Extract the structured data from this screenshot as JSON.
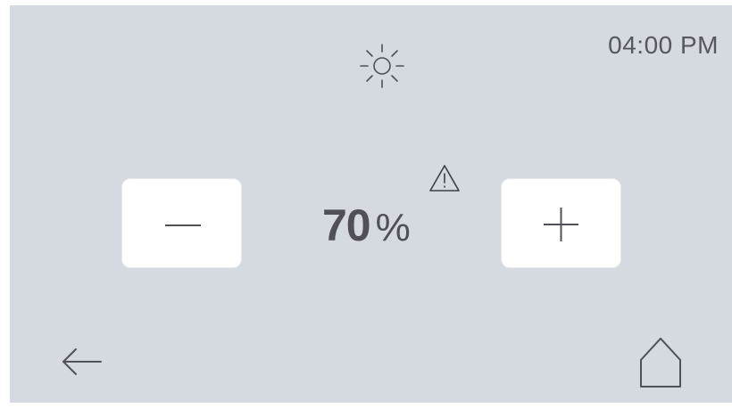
{
  "status": {
    "time": "04:00 PM",
    "mode_icon": "sun-icon",
    "warning_icon": "warning-icon"
  },
  "control": {
    "value": "70",
    "unit": "%",
    "decrease_icon": "minus-icon",
    "increase_icon": "plus-icon"
  },
  "nav": {
    "back_icon": "back-arrow-icon",
    "home_icon": "home-icon"
  },
  "colors": {
    "background": "#d5d9e0",
    "button": "#ffffff",
    "text": "#4f5157"
  }
}
